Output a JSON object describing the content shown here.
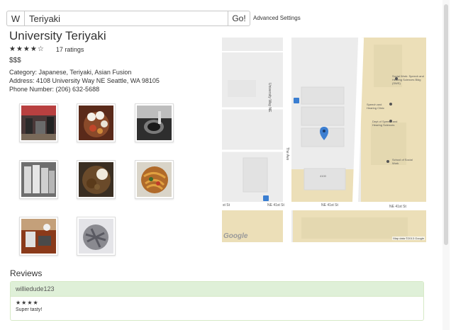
{
  "search": {
    "w_label": "W",
    "query": "Teriyaki",
    "go_label": "Go!",
    "advanced_label": "Advanced Settings"
  },
  "restaurant": {
    "name": "University Teriyaki",
    "stars_display": "★★★★☆",
    "rating_value": 4,
    "rating_max": 5,
    "ratings_count": "17 ratings",
    "price": "$$$",
    "category": "Category: Japanese, Teriyaki, Asian Fusion",
    "address": "Address: 4108 University Way NE Seattle, WA 98105",
    "phone": "Phone Number: (206) 632-5688"
  },
  "photos": [
    {
      "name": "photo-restaurant-interior",
      "color": "#5a3030"
    },
    {
      "name": "photo-dish-eggs",
      "color": "#6b3a22"
    },
    {
      "name": "photo-spoon-dish",
      "color": "#3a3a3a"
    },
    {
      "name": "photo-cups",
      "color": "#8a8a8a"
    },
    {
      "name": "photo-dish-rice",
      "color": "#6a5a3a"
    },
    {
      "name": "photo-dish-noodles",
      "color": "#9a5a2a"
    },
    {
      "name": "photo-table",
      "color": "#8a4a2a"
    },
    {
      "name": "photo-dish-grey",
      "color": "#7a7a80"
    }
  ],
  "map": {
    "street_vertical": "University Way NE",
    "street_the_ave": "The Ave",
    "street_41st_left": "NE 41st St",
    "street_41st_mid": "NE 41st St",
    "street_41st_right": "NE 41st St",
    "street_41st_far_left": "st St",
    "building_number": "4100",
    "poi_social_work_speech": "Social Work: Speech and Hearing Sciences Bldg (SWS)",
    "poi_speech_clinic": "Speech and Hearing Clinic",
    "poi_dept_speech": "Dept of Speech and Hearing Sciences",
    "poi_school_social_work": "School of Social Work",
    "google_label": "Google",
    "map_data_label": "Map data ©2013 Google",
    "colors": {
      "road": "#ffffff",
      "block": "#ececec",
      "campus": "#ecdfb8",
      "building": "#e2e2e2",
      "pin": "#3d7fd1"
    }
  },
  "reviews": {
    "heading": "Reviews",
    "items": [
      {
        "user": "williedude123",
        "stars_display": "★★★★",
        "rating_value": 4,
        "text": "Super tasty!"
      }
    ]
  },
  "colors": {
    "review_header_bg": "#dff0d8",
    "review_border": "#d6e9c6"
  }
}
